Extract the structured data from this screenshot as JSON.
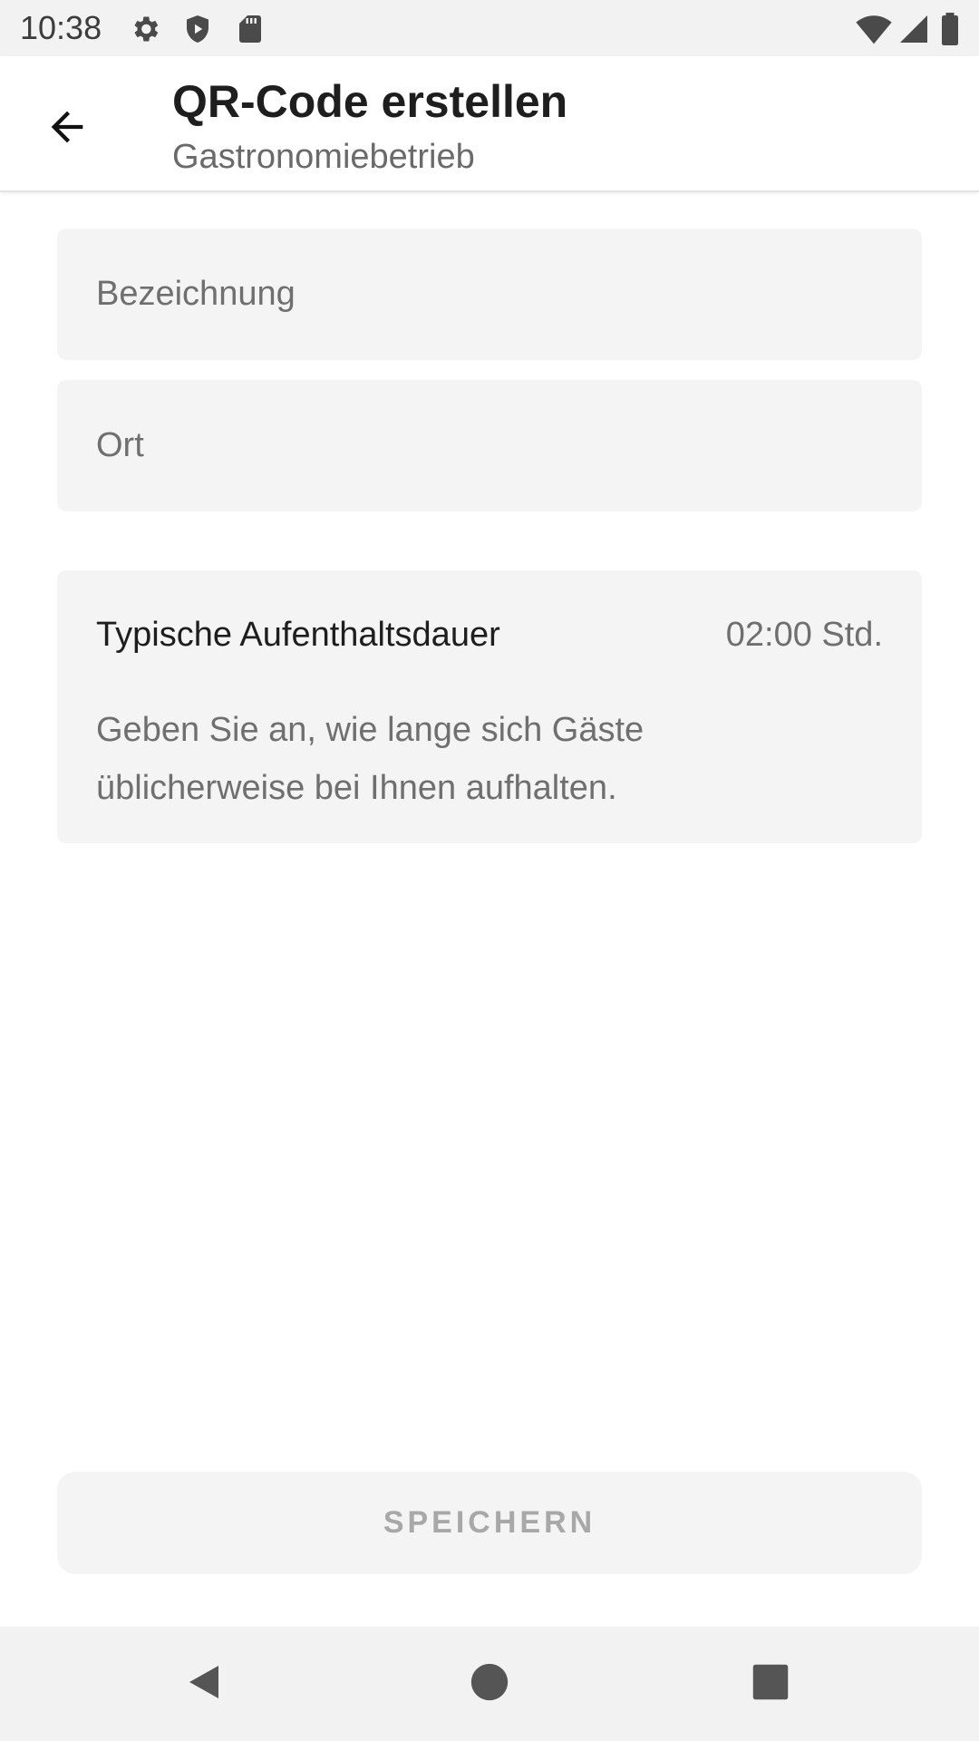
{
  "status_bar": {
    "time": "10:38",
    "left_icons": [
      "settings-icon",
      "shield-play-icon",
      "sd-card-icon"
    ],
    "right_icons": [
      "wifi-icon",
      "cell-signal-icon",
      "battery-icon"
    ]
  },
  "app_bar": {
    "back_icon": "arrow-left-icon",
    "title": "QR-Code erstellen",
    "subtitle": "Gastronomiebetrieb"
  },
  "form": {
    "name_field": {
      "value": "",
      "placeholder": "Bezeichnung"
    },
    "location_field": {
      "value": "",
      "placeholder": "Ort"
    },
    "duration": {
      "label": "Typische Aufenthaltsdauer",
      "value": "02:00 Std.",
      "hint": "Geben Sie an, wie lange sich Gäste üblicherweise bei Ihnen aufhalten."
    }
  },
  "actions": {
    "save_label": "SPEICHERN"
  },
  "nav_bar": {
    "icons": [
      "back-triangle-icon",
      "home-circle-icon",
      "recents-square-icon"
    ]
  },
  "colors": {
    "field_background": "#f4f4f4",
    "bar_background": "#f2f2f2",
    "disabled_text": "#a8a8a8"
  }
}
